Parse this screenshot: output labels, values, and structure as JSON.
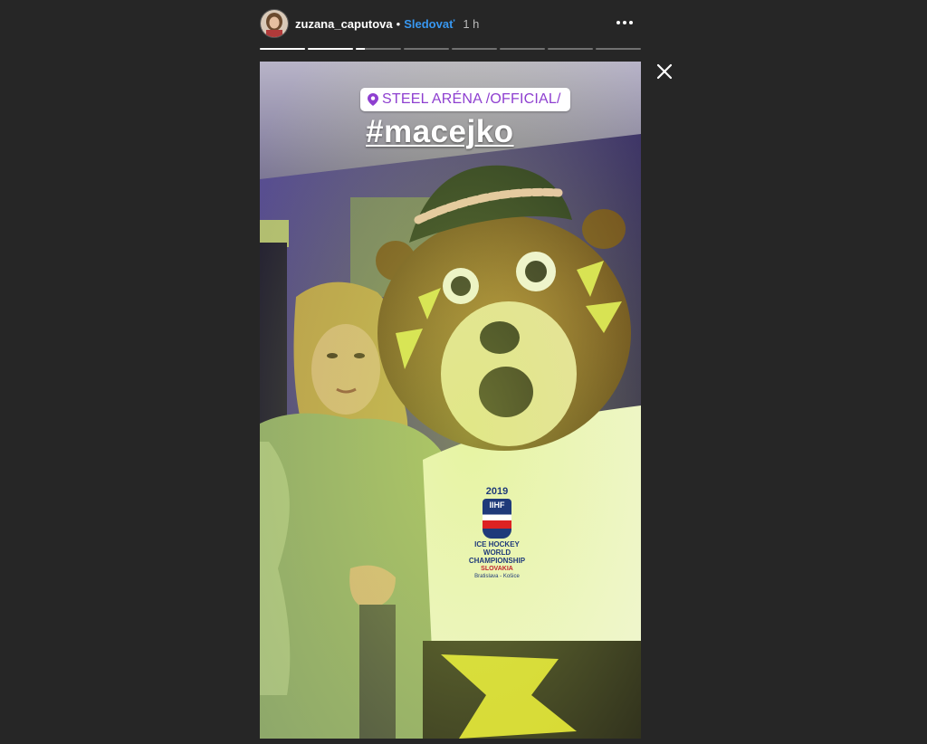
{
  "header": {
    "username": "zuzana_caputova",
    "separator": "•",
    "follow_label": "Sledovať",
    "time_ago": "1 h"
  },
  "progress": {
    "segment_count": 8,
    "segments_completed": 2,
    "current_segment_progress": 0.2
  },
  "story": {
    "location_sticker": "STEEL ARÉNA /OFFICIAL/",
    "hashtag": "#macejko",
    "shirt": {
      "year": "2019",
      "badge": "IIHF",
      "line1": "ICE HOCKEY",
      "line2": "WORLD",
      "line3": "CHAMPIONSHIP",
      "line4": "SLOVAKIA",
      "line5": "Bratislava - Košice"
    }
  },
  "icons": {
    "more": "more-options-icon",
    "close": "close-icon",
    "pin": "location-pin-icon"
  },
  "colors": {
    "background": "#262626",
    "follow_link": "#3897f0",
    "location_text": "#8e3fd0"
  }
}
